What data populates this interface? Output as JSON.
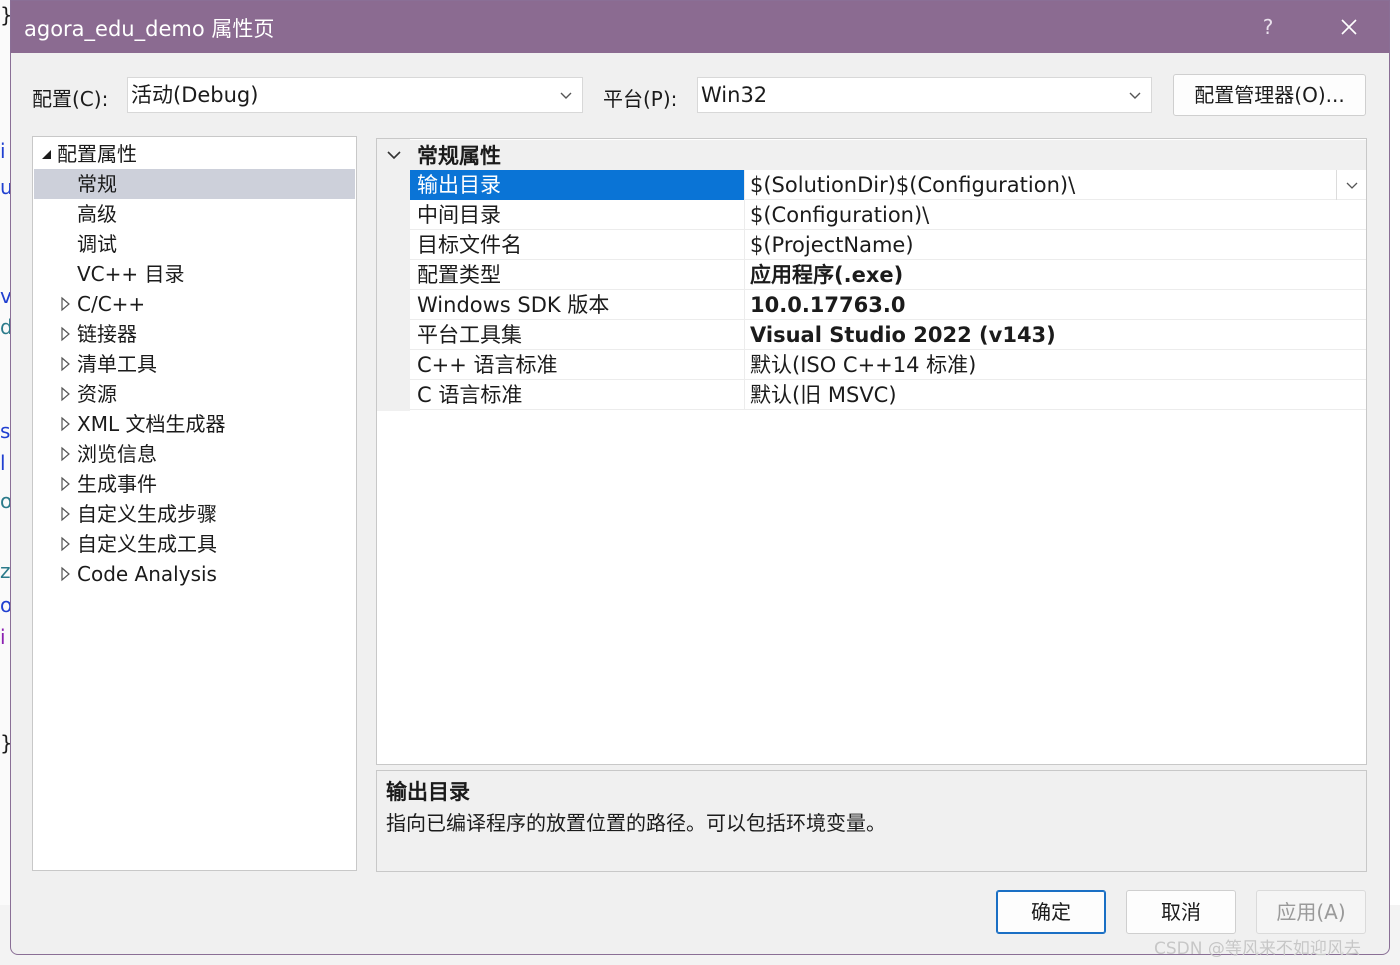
{
  "window": {
    "title": "agora_edu_demo 属性页",
    "help_label": "?"
  },
  "toolbar": {
    "config_label": "配置(C):",
    "config_value": "活动(Debug)",
    "platform_label": "平台(P):",
    "platform_value": "Win32",
    "config_manager_label": "配置管理器(O)..."
  },
  "tree": {
    "root_label": "配置属性",
    "items": [
      {
        "label": "常规",
        "expandable": false,
        "selected": true
      },
      {
        "label": "高级",
        "expandable": false
      },
      {
        "label": "调试",
        "expandable": false
      },
      {
        "label": "VC++ 目录",
        "expandable": false
      },
      {
        "label": "C/C++",
        "expandable": true
      },
      {
        "label": "链接器",
        "expandable": true
      },
      {
        "label": "清单工具",
        "expandable": true
      },
      {
        "label": "资源",
        "expandable": true
      },
      {
        "label": "XML 文档生成器",
        "expandable": true
      },
      {
        "label": "浏览信息",
        "expandable": true
      },
      {
        "label": "生成事件",
        "expandable": true
      },
      {
        "label": "自定义生成步骤",
        "expandable": true
      },
      {
        "label": "自定义生成工具",
        "expandable": true
      },
      {
        "label": "Code Analysis",
        "expandable": true
      }
    ]
  },
  "grid": {
    "category": "常规属性",
    "rows": [
      {
        "name": "输出目录",
        "value": "$(SolutionDir)$(Configuration)\\"
      },
      {
        "name": "中间目录",
        "value": "$(Configuration)\\"
      },
      {
        "name": "目标文件名",
        "value": "$(ProjectName)"
      },
      {
        "name": "配置类型",
        "value": "应用程序(.exe)"
      },
      {
        "name": "Windows SDK 版本",
        "value": "10.0.17763.0"
      },
      {
        "name": "平台工具集",
        "value": "Visual Studio 2022 (v143)"
      },
      {
        "name": "C++ 语言标准",
        "value": "默认(ISO C++14 标准)"
      },
      {
        "name": "C 语言标准",
        "value": "默认(旧 MSVC)"
      }
    ]
  },
  "description": {
    "title": "输出目录",
    "text": "指向已编译程序的放置位置的路径。可以包括环境变量。"
  },
  "buttons": {
    "ok": "确定",
    "cancel": "取消",
    "apply": "应用(A)"
  },
  "watermark": "CSDN @等风来不如迎风去"
}
